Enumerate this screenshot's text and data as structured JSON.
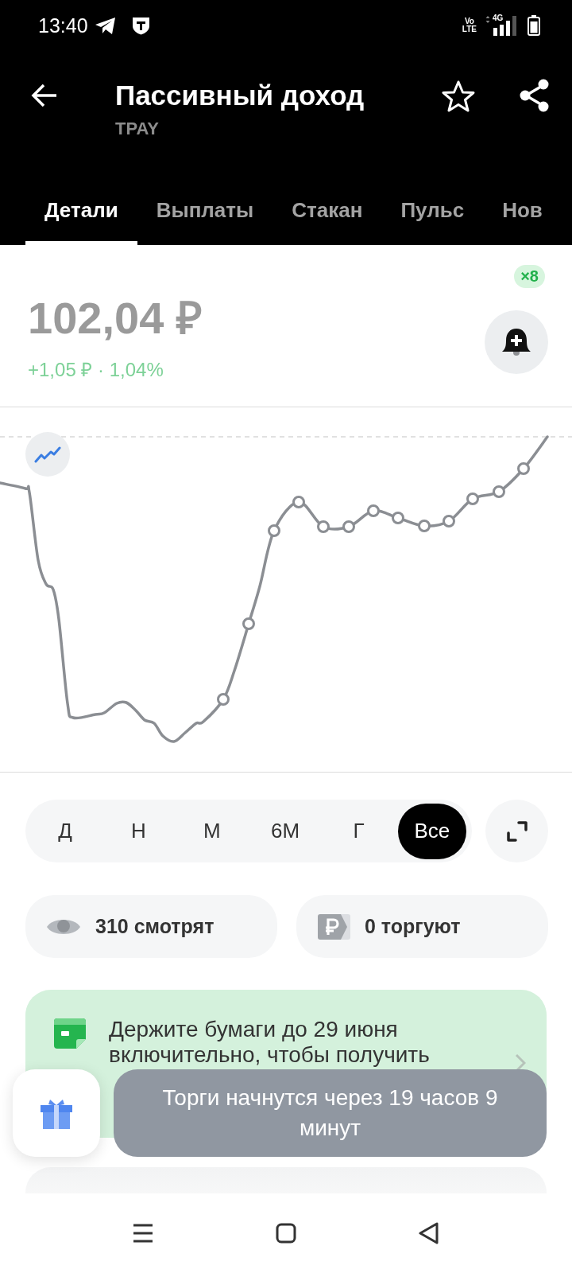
{
  "status_bar": {
    "time": "13:40",
    "volte_label": [
      "Vo",
      "LTE"
    ],
    "network_type": "4G"
  },
  "header": {
    "title": "Пассивный доход",
    "ticker": "TPAY",
    "favorite": false
  },
  "tabs": [
    {
      "label": "Детали",
      "selected": true
    },
    {
      "label": "Выплаты",
      "selected": false
    },
    {
      "label": "Стакан",
      "selected": false
    },
    {
      "label": "Пульс",
      "selected": false
    },
    {
      "label": "Нов",
      "selected": false
    }
  ],
  "quote": {
    "price": "102,04 ₽",
    "change": "+1,05 ₽ · 1,04%",
    "alerts_badge": "×8"
  },
  "periods": [
    {
      "label": "Д",
      "selected": false
    },
    {
      "label": "Н",
      "selected": false
    },
    {
      "label": "М",
      "selected": false
    },
    {
      "label": "6М",
      "selected": false
    },
    {
      "label": "Г",
      "selected": false
    },
    {
      "label": "Все",
      "selected": true
    }
  ],
  "stats": [
    {
      "kind": "viewers",
      "label": "310 смотрят"
    },
    {
      "kind": "traders",
      "label": "0 торгуют"
    }
  ],
  "notice": {
    "text": "Держите бумаги до 29 июня включительно, чтобы получить"
  },
  "toast": {
    "text": "Торги начнутся через 19 часов 9 минут"
  }
}
